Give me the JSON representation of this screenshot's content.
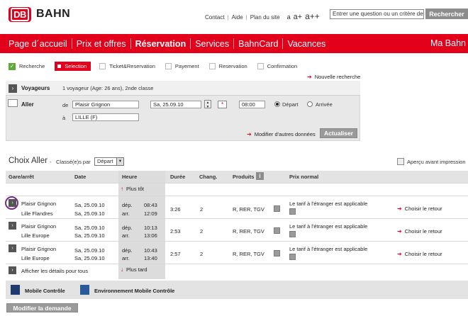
{
  "header": {
    "logo": "DB",
    "brand": "BAHN",
    "links": [
      "Contact",
      "Aide",
      "Plan du site"
    ],
    "font_sizes": [
      "a",
      "a+",
      "a++"
    ],
    "search_placeholder": "Entrer une question ou un critère de re",
    "search_button": "Rechercher"
  },
  "nav": {
    "items": [
      "Page d´accueil",
      "Prix et offres",
      "Réservation",
      "Services",
      "BahnCard",
      "Vacances"
    ],
    "active": "Réservation",
    "right": "Ma Bahn"
  },
  "steps": [
    "Recherche",
    "Selection",
    "Ticket&Reservation",
    "Payement",
    "Reservation",
    "Confirmation"
  ],
  "new_search": "Nouvelle recherche",
  "search": {
    "voyageurs_label": "Voyageurs",
    "voyageurs_value": "1 voyageur (Age: 26 ans), 2nde classe",
    "aller_label": "Aller",
    "de_label": "de",
    "de_value": "Plaisir Grignon",
    "a_label": "à",
    "a_value": "LILLE (F)",
    "date_value": "Sa, 25.09.10",
    "time_value": "08:00",
    "depart_label": "Départ",
    "arrivee_label": "Arrivée",
    "modifier_link": "Modifier d'autres données",
    "actualiser_button": "Actualiser"
  },
  "choix": {
    "title": "Choix Aller",
    "dash": "-",
    "sort_label": "Classé(e)s par",
    "sort_value": "Départ",
    "apercu": "Aperçu avant impression"
  },
  "table": {
    "headers": [
      "Gare/arrêt",
      "Date",
      "Heure",
      "Durée",
      "Chang.",
      "Produits",
      "Prix normal"
    ],
    "plus_tot": "Plus tôt",
    "plus_tard": "Plus tard",
    "afficher": "Afficher les détails pour tous",
    "rows": [
      {
        "from": "Plaisir Grignon",
        "to": "Lille Flandres",
        "date1": "Sa, 25.09.10",
        "date2": "Sa, 25.09.10",
        "dep_label": "dép.",
        "arr_label": "arr.",
        "dep": "08:43",
        "arr": "12:09",
        "duree": "3:26",
        "chang": "2",
        "produits": "R, RER, TGV",
        "prix": "Le tarif à l'étranger est applicable",
        "choisir": "Choisir le retour"
      },
      {
        "from": "Plaisir Grignon",
        "to": "Lille Europe",
        "date1": "Sa, 25.09.10",
        "date2": "Sa, 25.09.10",
        "dep_label": "dép.",
        "arr_label": "arr.",
        "dep": "10:13",
        "arr": "13:06",
        "duree": "2:53",
        "chang": "2",
        "produits": "R, RER, TGV",
        "prix": "Le tarif à l'étranger est applicable",
        "choisir": "Choisir le retour"
      },
      {
        "from": "Plaisir Grignon",
        "to": "Lille Europe",
        "date1": "Sa, 25.09.10",
        "date2": "Sa, 25.09.10",
        "dep_label": "dép.",
        "arr_label": "arr.",
        "dep": "10:43",
        "arr": "13:40",
        "duree": "2:57",
        "chang": "2",
        "produits": "R, RER, TGV",
        "prix": "Le tarif à l'étranger est applicable",
        "choisir": "Choisir le retour"
      }
    ]
  },
  "footer": {
    "mobile": "Mobile Contrôle",
    "env": "Environnement Mobile Contrôle",
    "modifier": "Modifier la demande"
  }
}
